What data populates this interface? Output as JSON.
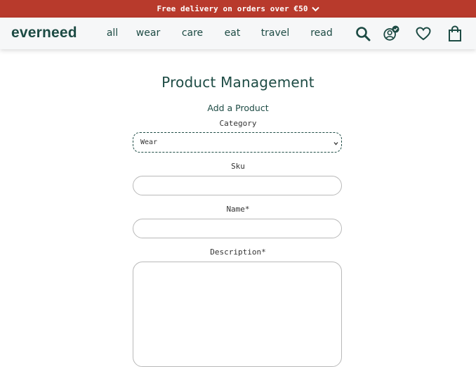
{
  "promo": {
    "text": "Free delivery on orders over €50",
    "icon": "chevron-down-icon"
  },
  "header": {
    "logo": "everneed",
    "nav": [
      "all",
      "wear",
      "care",
      "eat",
      "travel",
      "read"
    ],
    "icons": [
      "search-icon",
      "account-icon",
      "heart-icon",
      "bag-icon"
    ]
  },
  "colors": {
    "brand": "#1d4b44",
    "promo_bg": "#b83a2c",
    "header_bg": "#f6f7f8"
  },
  "main": {
    "title": "Product Management",
    "subtitle": "Add a Product",
    "fields": {
      "category_label": "Category",
      "category_value": "Wear",
      "sku_label": "Sku",
      "sku_value": "",
      "name_label": "Name*",
      "name_value": "",
      "description_label": "Description*",
      "description_value": ""
    }
  }
}
